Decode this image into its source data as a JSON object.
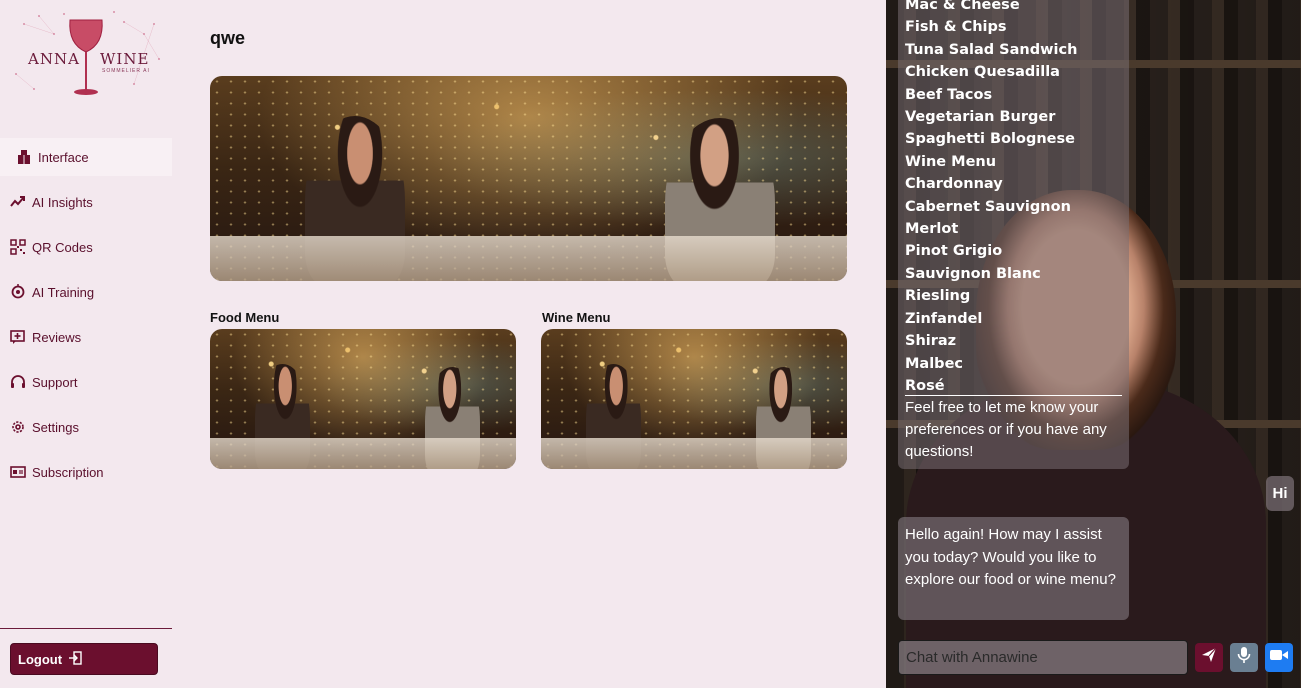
{
  "app": {
    "logo_left": "ANNA",
    "logo_right": "WINE",
    "logo_tagline": "SOMMELIER AI"
  },
  "sidebar": {
    "items": [
      {
        "label": "Interface",
        "icon": "wine-box-icon",
        "active": true
      },
      {
        "label": "AI Insights",
        "icon": "trend-chart-icon",
        "active": false
      },
      {
        "label": "QR Codes",
        "icon": "qr-code-icon",
        "active": false
      },
      {
        "label": "AI Training",
        "icon": "brain-icon",
        "active": false
      },
      {
        "label": "Reviews",
        "icon": "review-plus-icon",
        "active": false
      },
      {
        "label": "Support",
        "icon": "headset-icon",
        "active": false
      },
      {
        "label": "Settings",
        "icon": "gear-icon",
        "active": false
      },
      {
        "label": "Subscription",
        "icon": "subscription-icon",
        "active": false
      }
    ],
    "logout_label": "Logout"
  },
  "main": {
    "title": "qwe",
    "food_menu_label": "Food Menu",
    "wine_menu_label": "Wine Menu"
  },
  "chat": {
    "menu_items": [
      "Mac & Cheese",
      "Fish & Chips",
      "Tuna Salad Sandwich",
      "Chicken Quesadilla",
      "Beef Tacos",
      "Vegetarian Burger",
      "Spaghetti Bolognese",
      "Wine Menu",
      "Chardonnay",
      "Cabernet Sauvignon",
      "Merlot",
      "Pinot Grigio",
      "Sauvignon Blanc",
      "Riesling",
      "Zinfandel",
      "Shiraz",
      "Malbec",
      "Rosé"
    ],
    "menu_tail": "Feel free to let me know your preferences or if you have any questions!",
    "user_message": "Hi",
    "assistant_message": "Hello again! How may I assist you today? Would you like to explore our food or wine menu?",
    "input_placeholder": "Chat with Annawine",
    "colors": {
      "send": "#6b0f2e",
      "mic": "#6a7f92",
      "video": "#1e7cf2"
    }
  },
  "colors": {
    "brand": "#6b0f2e",
    "background": "#f3e8ee"
  }
}
